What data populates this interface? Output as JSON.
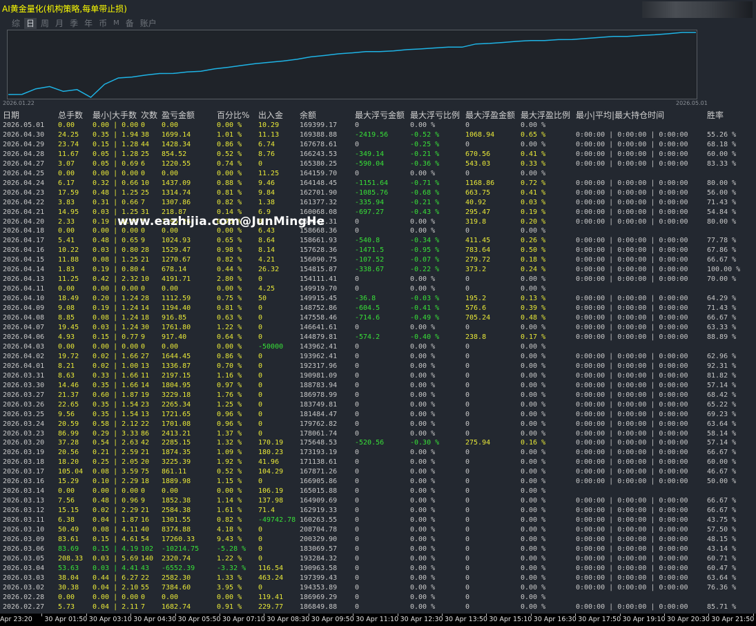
{
  "title": "AI黄金量化(机构策略,每单带止损)",
  "tabs": [
    "综",
    "日",
    "周",
    "月",
    "季",
    "年",
    "币",
    "M",
    "备",
    "账户"
  ],
  "active_tab": "日",
  "chart": {
    "x_start_label": "2026.01.22",
    "x_end_label": "2026.05.01",
    "line_color": "#1eb4e6"
  },
  "watermark": "www.eazhijia.com@JunMingHe",
  "columns": [
    "日期",
    "总手数",
    "最小|大手数",
    "次数",
    "盈亏金额",
    "百分比%",
    "出入金",
    "余额",
    "最大浮亏金额",
    "最大浮亏比例",
    "最大浮盈金额",
    "最大浮盈比例",
    "最小|平均|最大持仓时间",
    "胜率"
  ],
  "rows": [
    [
      "2026.05.01",
      "0.00",
      "0.00 | 0.00",
      "0",
      "0.00",
      "0.00 %",
      "10.29",
      "169399.17",
      "0",
      "0.00 %",
      "0",
      "0.00 %",
      "",
      ""
    ],
    [
      "2026.04.30",
      "24.25",
      "0.35 | 1.94",
      "38",
      "1699.14",
      "1.01 %",
      "11.13",
      "169388.88",
      "-2419.56",
      "-0.52 %",
      "1068.94",
      "0.65 %",
      "0:00:00 | 0:00:00 | 0:00:00",
      "55.26 %"
    ],
    [
      "2026.04.29",
      "23.74",
      "0.15 | 1.28",
      "44",
      "1428.34",
      "0.86 %",
      "6.74",
      "167678.61",
      "0",
      "-0.25 %",
      "0",
      "0.00 %",
      "0:00:00 | 0:00:00 | 0:00:00",
      "68.18 %"
    ],
    [
      "2026.04.28",
      "11.67",
      "0.05 | 1.28",
      "25",
      "854.52",
      "0.52 %",
      "8.76",
      "166243.53",
      "-349.14",
      "-0.21 %",
      "670.56",
      "0.41 %",
      "0:00:00 | 0:00:00 | 0:00:00",
      "60.00 %"
    ],
    [
      "2026.04.27",
      "3.07",
      "0.05 | 0.69",
      "6",
      "1220.55",
      "0.74 %",
      "0",
      "165380.25",
      "-590.04",
      "-0.36 %",
      "543.03",
      "0.33 %",
      "0:00:00 | 0:00:00 | 0:00:00",
      "83.33 %"
    ],
    [
      "2026.04.25",
      "0.00",
      "0.00 | 0.00",
      "0",
      "0.00",
      "0.00 %",
      "11.25",
      "164159.70",
      "0",
      "0.00 %",
      "0",
      "0.00 %",
      "",
      ""
    ],
    [
      "2026.04.24",
      "6.17",
      "0.32 | 0.66",
      "10",
      "1437.09",
      "0.88 %",
      "9.46",
      "164148.45",
      "-1151.64",
      "-0.71 %",
      "1168.86",
      "0.72 %",
      "0:00:00 | 0:00:00 | 0:00:00",
      "80.00 %"
    ],
    [
      "2026.04.23",
      "17.59",
      "0.48 | 1.25",
      "25",
      "1314.74",
      "0.81 %",
      "9.84",
      "162701.90",
      "-1085.76",
      "-0.68 %",
      "663.75",
      "0.41 %",
      "0:00:00 | 0:00:00 | 0:00:00",
      "56.00 %"
    ],
    [
      "2026.04.22",
      "3.83",
      "0.31 | 0.66",
      "7",
      "1307.86",
      "0.82 %",
      "1.38",
      "161377.32",
      "-335.94",
      "-0.21 %",
      "40.92",
      "0.03 %",
      "0:00:00 | 0:00:00 | 0:00:00",
      "71.43 %"
    ],
    [
      "2026.04.21",
      "14.95",
      "0.03 | 1.25",
      "31",
      "218.87",
      "0.14 %",
      "6.9",
      "160068.08",
      "-697.27",
      "-0.43 %",
      "295.47",
      "0.19 %",
      "0:00:00 | 0:00:00 | 0:00:00",
      "54.84 %"
    ],
    [
      "2026.04.20",
      "2.33",
      "0.19 | 0.44",
      "5",
      "1195.26",
      "0.75 %",
      "0",
      "159842.31",
      "0",
      "0.00 %",
      "319.8",
      "0.20 %",
      "0:00:00 | 0:00:00 | 0:00:00",
      "80.00 %"
    ],
    [
      "2026.04.18",
      "0.00",
      "0.00 | 0.00",
      "0",
      "0.00",
      "0.00 %",
      "6.43",
      "158668.36",
      "0",
      "0.00 %",
      "0",
      "0.00 %",
      "",
      ""
    ],
    [
      "2026.04.17",
      "5.41",
      "0.48 | 0.65",
      "9",
      "1024.93",
      "0.65 %",
      "8.64",
      "158661.93",
      "-540.8",
      "-0.34 %",
      "411.45",
      "0.26 %",
      "0:00:00 | 0:00:00 | 0:00:00",
      "77.78 %"
    ],
    [
      "2026.04.16",
      "10.22",
      "0.03 | 0.80",
      "28",
      "1529.47",
      "0.98 %",
      "8.14",
      "157628.36",
      "-1471.5",
      "-0.95 %",
      "783.64",
      "0.50 %",
      "0:00:00 | 0:00:00 | 0:00:00",
      "67.86 %"
    ],
    [
      "2026.04.15",
      "11.88",
      "0.08 | 1.25",
      "21",
      "1270.67",
      "0.82 %",
      "4.21",
      "156090.75",
      "-107.52",
      "-0.07 %",
      "279.72",
      "0.18 %",
      "0:00:00 | 0:00:00 | 0:00:00",
      "66.67 %"
    ],
    [
      "2026.04.14",
      "1.83",
      "0.19 | 0.80",
      "4",
      "678.14",
      "0.44 %",
      "26.32",
      "154815.87",
      "-338.67",
      "-0.22 %",
      "373.2",
      "0.24 %",
      "0:00:00 | 0:00:00 | 0:00:00",
      "100.00 %"
    ],
    [
      "2026.04.13",
      "11.25",
      "0.42 | 2.32",
      "10",
      "4191.71",
      "2.80 %",
      "0",
      "154111.41",
      "0",
      "0.00 %",
      "0",
      "0.00 %",
      "0:00:00 | 0:00:00 | 0:00:00",
      "70.00 %"
    ],
    [
      "2026.04.11",
      "0.00",
      "0.00 | 0.00",
      "0",
      "0.00",
      "0.00 %",
      "4.25",
      "149919.70",
      "0",
      "0.00 %",
      "0",
      "0.00 %",
      "",
      ""
    ],
    [
      "2026.04.10",
      "18.49",
      "0.20 | 1.24",
      "28",
      "1112.59",
      "0.75 %",
      "50",
      "149915.45",
      "-36.8",
      "-0.03 %",
      "195.2",
      "0.13 %",
      "0:00:00 | 0:00:00 | 0:00:00",
      "64.29 %"
    ],
    [
      "2026.04.09",
      "9.08",
      "0.19 | 1.24",
      "14",
      "1194.40",
      "0.81 %",
      "0",
      "148752.86",
      "-604.5",
      "-0.41 %",
      "576.6",
      "0.39 %",
      "0:00:00 | 0:00:00 | 0:00:00",
      "71.43 %"
    ],
    [
      "2026.04.08",
      "8.85",
      "0.08 | 1.24",
      "18",
      "916.85",
      "0.63 %",
      "0",
      "147558.46",
      "-714.6",
      "-0.49 %",
      "705.24",
      "0.48 %",
      "0:00:00 | 0:00:00 | 0:00:00",
      "66.67 %"
    ],
    [
      "2026.04.07",
      "19.45",
      "0.03 | 1.24",
      "30",
      "1761.80",
      "1.22 %",
      "0",
      "146641.61",
      "0",
      "0.00 %",
      "0",
      "0.00 %",
      "0:00:00 | 0:00:00 | 0:00:00",
      "63.33 %"
    ],
    [
      "2026.04.06",
      "4.93",
      "0.15 | 0.77",
      "9",
      "917.40",
      "0.64 %",
      "0",
      "144879.81",
      "-574.2",
      "-0.40 %",
      "238.8",
      "0.17 %",
      "0:00:00 | 0:00:00 | 0:00:00",
      "88.89 %"
    ],
    [
      "2026.04.03",
      "0.00",
      "0.00 | 0.00",
      "0",
      "0.00",
      "0.00 %",
      "-50000",
      "143962.41",
      "0",
      "0.00 %",
      "0",
      "0.00 %",
      "",
      ""
    ],
    [
      "2026.04.02",
      "19.72",
      "0.02 | 1.66",
      "27",
      "1644.45",
      "0.86 %",
      "0",
      "193962.41",
      "0",
      "0.00 %",
      "0",
      "0.00 %",
      "0:00:00 | 0:00:00 | 0:00:00",
      "62.96 %"
    ],
    [
      "2026.04.01",
      "8.21",
      "0.02 | 1.00",
      "13",
      "1336.87",
      "0.70 %",
      "0",
      "192317.96",
      "0",
      "0.00 %",
      "0",
      "0.00 %",
      "0:00:00 | 0:00:00 | 0:00:00",
      "92.31 %"
    ],
    [
      "2026.03.31",
      "8.63",
      "0.33 | 1.66",
      "11",
      "2197.15",
      "1.16 %",
      "0",
      "190981.09",
      "0",
      "0.00 %",
      "0",
      "0.00 %",
      "0:00:00 | 0:00:00 | 0:00:00",
      "81.82 %"
    ],
    [
      "2026.03.30",
      "14.46",
      "0.35 | 1.66",
      "14",
      "1804.95",
      "0.97 %",
      "0",
      "188783.94",
      "0",
      "0.00 %",
      "0",
      "0.00 %",
      "0:00:00 | 0:00:00 | 0:00:00",
      "57.14 %"
    ],
    [
      "2026.03.27",
      "21.37",
      "0.60 | 1.87",
      "19",
      "3229.18",
      "1.76 %",
      "0",
      "186978.99",
      "0",
      "0.00 %",
      "0",
      "0.00 %",
      "0:00:00 | 0:00:00 | 0:00:00",
      "68.42 %"
    ],
    [
      "2026.03.26",
      "22.65",
      "0.35 | 1.54",
      "23",
      "2265.34",
      "1.25 %",
      "0",
      "183749.81",
      "0",
      "0.00 %",
      "0",
      "0.00 %",
      "0:00:00 | 0:00:00 | 0:00:00",
      "65.22 %"
    ],
    [
      "2026.03.25",
      "9.56",
      "0.35 | 1.54",
      "13",
      "1721.65",
      "0.96 %",
      "0",
      "181484.47",
      "0",
      "0.00 %",
      "0",
      "0.00 %",
      "0:00:00 | 0:00:00 | 0:00:00",
      "69.23 %"
    ],
    [
      "2026.03.24",
      "20.59",
      "0.58 | 2.12",
      "22",
      "1701.08",
      "0.96 %",
      "0",
      "179762.82",
      "0",
      "0.00 %",
      "0",
      "0.00 %",
      "0:00:00 | 0:00:00 | 0:00:00",
      "63.64 %"
    ],
    [
      "2026.03.23",
      "86.99",
      "0.29 | 3.33",
      "86",
      "2413.21",
      "1.37 %",
      "0",
      "178061.74",
      "0",
      "0.00 %",
      "0",
      "0.00 %",
      "0:00:00 | 0:00:00 | 0:00:00",
      "58.14 %"
    ],
    [
      "2026.03.20",
      "37.28",
      "0.54 | 2.63",
      "42",
      "2285.15",
      "1.32 %",
      "170.19",
      "175648.53",
      "-520.56",
      "-0.30 %",
      "275.94",
      "0.16 %",
      "0:00:00 | 0:00:00 | 0:00:00",
      "57.14 %"
    ],
    [
      "2026.03.19",
      "20.56",
      "0.21 | 2.59",
      "21",
      "1874.35",
      "1.09 %",
      "180.23",
      "173193.19",
      "0",
      "0.00 %",
      "0",
      "0.00 %",
      "0:00:00 | 0:00:00 | 0:00:00",
      "66.67 %"
    ],
    [
      "2026.03.18",
      "18.20",
      "0.25 | 2.05",
      "20",
      "3225.39",
      "1.92 %",
      "41.96",
      "171138.61",
      "0",
      "0.00 %",
      "0",
      "0.00 %",
      "0:00:00 | 0:00:00 | 0:00:00",
      "60.00 %"
    ],
    [
      "2026.03.17",
      "105.04",
      "0.08 | 3.59",
      "75",
      "861.11",
      "0.52 %",
      "104.29",
      "167871.26",
      "0",
      "0.00 %",
      "0",
      "0.00 %",
      "0:00:00 | 0:00:00 | 0:00:00",
      "46.67 %"
    ],
    [
      "2026.03.16",
      "15.29",
      "0.10 | 2.29",
      "18",
      "1889.98",
      "1.15 %",
      "0",
      "166905.86",
      "0",
      "0.00 %",
      "0",
      "0.00 %",
      "0:00:00 | 0:00:00 | 0:00:00",
      "50.00 %"
    ],
    [
      "2026.03.14",
      "0.00",
      "0.00 | 0.00",
      "0",
      "0.00",
      "0.00 %",
      "106.19",
      "165015.88",
      "0",
      "0.00 %",
      "0",
      "0.00 %",
      "",
      ""
    ],
    [
      "2026.03.13",
      "7.56",
      "0.48 | 0.96",
      "9",
      "1852.38",
      "1.14 %",
      "137.98",
      "164909.69",
      "0",
      "0.00 %",
      "0",
      "0.00 %",
      "0:00:00 | 0:00:00 | 0:00:00",
      "66.67 %"
    ],
    [
      "2026.03.12",
      "15.15",
      "0.02 | 2.29",
      "21",
      "2584.38",
      "1.61 %",
      "71.4",
      "162919.33",
      "0",
      "0.00 %",
      "0",
      "0.00 %",
      "0:00:00 | 0:00:00 | 0:00:00",
      "66.67 %"
    ],
    [
      "2026.03.11",
      "6.38",
      "0.04 | 1.87",
      "16",
      "1301.55",
      "0.82 %",
      "-49742.78",
      "160263.55",
      "0",
      "0.00 %",
      "0",
      "0.00 %",
      "0:00:00 | 0:00:00 | 0:00:00",
      "43.75 %"
    ],
    [
      "2026.03.10",
      "50.49",
      "0.08 | 4.11",
      "40",
      "8374.88",
      "4.18 %",
      "0",
      "208704.78",
      "0",
      "0.00 %",
      "0",
      "0.00 %",
      "0:00:00 | 0:00:00 | 0:00:00",
      "57.50 %"
    ],
    [
      "2026.03.09",
      "83.61",
      "0.15 | 4.61",
      "54",
      "17260.33",
      "9.43 %",
      "0",
      "200329.90",
      "0",
      "0.00 %",
      "0",
      "0.00 %",
      "0:00:00 | 0:00:00 | 0:00:00",
      "48.15 %"
    ],
    [
      "2026.03.06",
      "83.69",
      "0.15 | 4.19",
      "102",
      "-10214.75",
      "-5.28 %",
      "0",
      "183069.57",
      "0",
      "0.00 %",
      "0",
      "0.00 %",
      "0:00:00 | 0:00:00 | 0:00:00",
      "43.14 %"
    ],
    [
      "2026.03.05",
      "208.33",
      "0.03 | 5.69",
      "140",
      "2320.74",
      "1.22 %",
      "0",
      "193284.32",
      "0",
      "0.00 %",
      "0",
      "0.00 %",
      "0:00:00 | 0:00:00 | 0:00:00",
      "60.71 %"
    ],
    [
      "2026.03.04",
      "53.63",
      "0.03 | 4.41",
      "43",
      "-6552.39",
      "-3.32 %",
      "116.54",
      "190963.58",
      "0",
      "0.00 %",
      "0",
      "0.00 %",
      "0:00:00 | 0:00:00 | 0:00:00",
      "60.47 %"
    ],
    [
      "2026.03.03",
      "38.04",
      "0.44 | 6.27",
      "22",
      "2582.30",
      "1.33 %",
      "463.24",
      "197399.43",
      "0",
      "0.00 %",
      "0",
      "0.00 %",
      "0:00:00 | 0:00:00 | 0:00:00",
      "63.64 %"
    ],
    [
      "2026.03.02",
      "30.38",
      "0.04 | 2.10",
      "55",
      "7384.60",
      "3.95 %",
      "0",
      "194353.89",
      "0",
      "0.00 %",
      "0",
      "0.00 %",
      "0:00:00 | 0:00:00 | 0:00:00",
      "76.36 %"
    ],
    [
      "2026.02.28",
      "0.00",
      "0.00 | 0.00",
      "0",
      "0.00",
      "0.00 %",
      "119.41",
      "186969.29",
      "0",
      "0.00 %",
      "0",
      "0.00 %",
      "",
      ""
    ],
    [
      "2026.02.27",
      "5.73",
      "0.04 | 2.11",
      "7",
      "1682.74",
      "0.91 %",
      "229.77",
      "186849.88",
      "0",
      "0.00 %",
      "0",
      "0.00 %",
      "0:00:00 | 0:00:00 | 0:00:00",
      "85.71 %"
    ]
  ],
  "green_rows": [
    "2026.03.06",
    "2026.03.04"
  ],
  "time_axis": [
    "Apr 23:20",
    "30 Apr 01:50",
    "30 Apr 03:10",
    "30 Apr 04:30",
    "30 Apr 05:50",
    "30 Apr 07:10",
    "30 Apr 08:30",
    "30 Apr 09:50",
    "30 Apr 11:10",
    "30 Apr 12:30",
    "30 Apr 13:50",
    "30 Apr 15:10",
    "30 Apr 16:30",
    "30 Apr 17:50",
    "30 Apr 19:10",
    "30 Apr 20:30",
    "30 Apr 21:50",
    "30 Ap"
  ]
}
